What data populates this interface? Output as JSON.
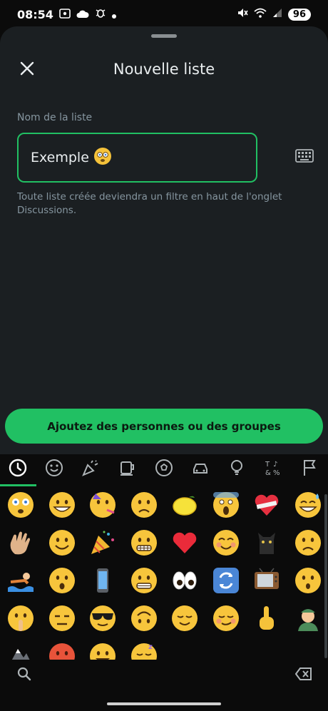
{
  "status_bar": {
    "time": "08:54",
    "battery": "96"
  },
  "dialog": {
    "title": "Nouvelle liste",
    "field_label": "Nom de la liste",
    "input_value": "Exemple",
    "helper_text": "Toute liste créée deviendra un filtre en haut de l'onglet Discussions.",
    "add_button": "Ajoutez des personnes ou des groupes"
  },
  "emoji_tabs": [
    "recent-icon",
    "smileys-icon",
    "celebration-icon",
    "food-icon",
    "activity-icon",
    "travel-icon",
    "objects-icon",
    "symbols-icon",
    "flags-icon"
  ],
  "emoji_rows": [
    [
      "dizzy",
      "grin",
      "party",
      "frown",
      "lemon",
      "scream",
      "heart-bandage",
      "sweat-smile"
    ],
    [
      "wave",
      "smile",
      "popper",
      "grimace",
      "heart",
      "blush",
      "cat",
      "frown2"
    ],
    [
      "swimmer",
      "hushed",
      "phone",
      "grimace2",
      "eyes",
      "arrows",
      "tv",
      "hushed2"
    ],
    [
      "shush",
      "neutral",
      "cool",
      "upside",
      "relieved",
      "smirk",
      "point",
      "worker"
    ],
    [
      "mountain",
      "hot",
      "grin2",
      "sleep"
    ]
  ],
  "colors": {
    "accent": "#21c063",
    "sheet": "#1b1f22",
    "background": "#0b0b0b"
  }
}
